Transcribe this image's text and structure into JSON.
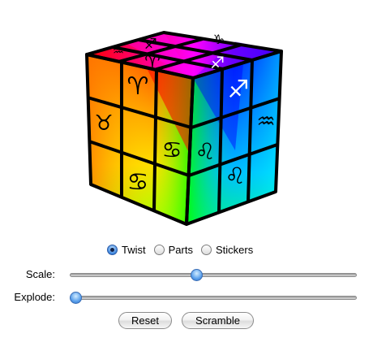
{
  "cube": {
    "top_glyphs": [
      "♐",
      "♑",
      "♒",
      "♈",
      "♐"
    ],
    "left_glyphs": [
      "♈",
      "♉",
      "♋",
      "♋"
    ],
    "right_glyphs": [
      "♐",
      "♒",
      "♌",
      "♌",
      "♒"
    ],
    "colors": {
      "red": "#ff0000",
      "magenta": "#ff0080",
      "purple": "#8000ff",
      "blue": "#0000ff",
      "orange": "#ff8000",
      "yellow": "#ffff00",
      "lime": "#80ff00",
      "green": "#00ff00",
      "cyan": "#00ff80",
      "sky": "#0080ff",
      "teal": "#00ffff",
      "grid": "#000000"
    }
  },
  "mode": {
    "options": [
      {
        "label": "Twist",
        "selected": true
      },
      {
        "label": "Parts",
        "selected": false
      },
      {
        "label": "Stickers",
        "selected": false
      }
    ]
  },
  "sliders": {
    "scale": {
      "label": "Scale:",
      "value": 0.44
    },
    "explode": {
      "label": "Explode:",
      "value": 0.0
    }
  },
  "buttons": {
    "reset_label": "Reset",
    "scramble_label": "Scramble"
  }
}
